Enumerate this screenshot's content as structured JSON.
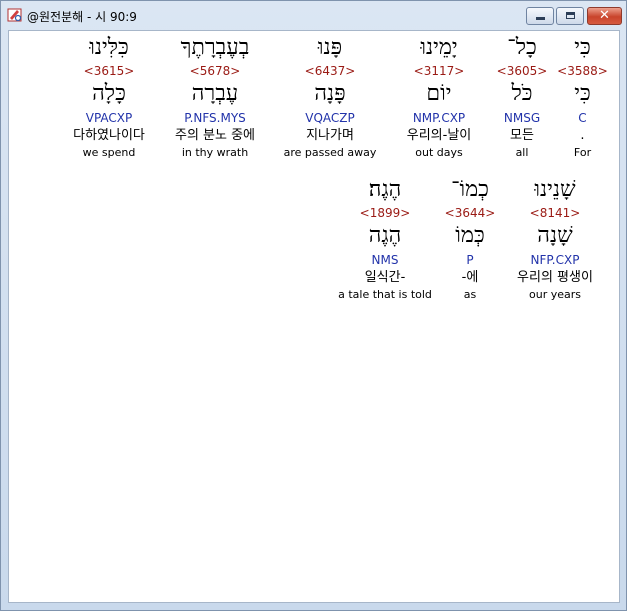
{
  "window": {
    "title": "@원전분해 - 시 90:9",
    "minimize_label": "",
    "maximize_label": "",
    "close_label": "✕"
  },
  "rows": [
    {
      "words": [
        {
          "hebrew": "כִּי",
          "strong": "<3588>",
          "lemma": "כִּי",
          "morph": "C",
          "korean": ".",
          "english": "For",
          "selected": true
        },
        {
          "hebrew": "כָל־",
          "strong": "<3605>",
          "lemma": "כֹּל",
          "morph": "NMSG",
          "korean": "모든",
          "english": "all",
          "selected": false
        },
        {
          "hebrew": "יָמֵינוּ",
          "strong": "<3117>",
          "lemma": "יוֹם",
          "morph": "NMP.CXP",
          "korean": "우리의-날이",
          "english": "out days",
          "selected": false
        },
        {
          "hebrew": "פָּנוּ",
          "strong": "<6437>",
          "lemma": "פָּנָה",
          "morph": "VQACZP",
          "korean": "지나가며",
          "english": "are passed away",
          "selected": false
        },
        {
          "hebrew": "בְעֶבְרָתֶךָ",
          "strong": "<5678>",
          "lemma": "עֶבְרָה",
          "morph": "P.NFS.MYS",
          "korean": "주의 분노 중에",
          "english": "in thy wrath",
          "selected": false
        },
        {
          "hebrew": "כִּלִּינוּ",
          "strong": "<3615>",
          "lemma": "כָּלָה",
          "morph": "VPACXP",
          "korean": "다하였나이다",
          "english": "we spend",
          "selected": false
        }
      ]
    },
    {
      "words": [
        {
          "hebrew": "שָׁנֵינוּ",
          "strong": "<8141>",
          "lemma": "שָׁנָה",
          "morph": "NFP.CXP",
          "korean": "우리의 평생이",
          "english": "our years",
          "selected": false
        },
        {
          "hebrew": "כְמוֹ־",
          "strong": "<3644>",
          "lemma": "כְּמוֹ",
          "morph": "P",
          "korean": "-에",
          "english": "as",
          "selected": false
        },
        {
          "hebrew": "הֶגֶה׃",
          "strong": "<1899>",
          "lemma": "הֶגֶה",
          "morph": "NMS",
          "korean": "일식간-",
          "english": "a tale that is told",
          "selected": false
        }
      ]
    }
  ],
  "colors": {
    "strong": "#9a1a14",
    "morph": "#2233aa",
    "text": "#000000",
    "client_bg": "#ffffff",
    "frame_bg": "#dfe8f4"
  },
  "icons": {
    "app": "bible-app-icon",
    "minimize": "minimize-icon",
    "maximize": "maximize-icon",
    "close": "close-icon"
  }
}
